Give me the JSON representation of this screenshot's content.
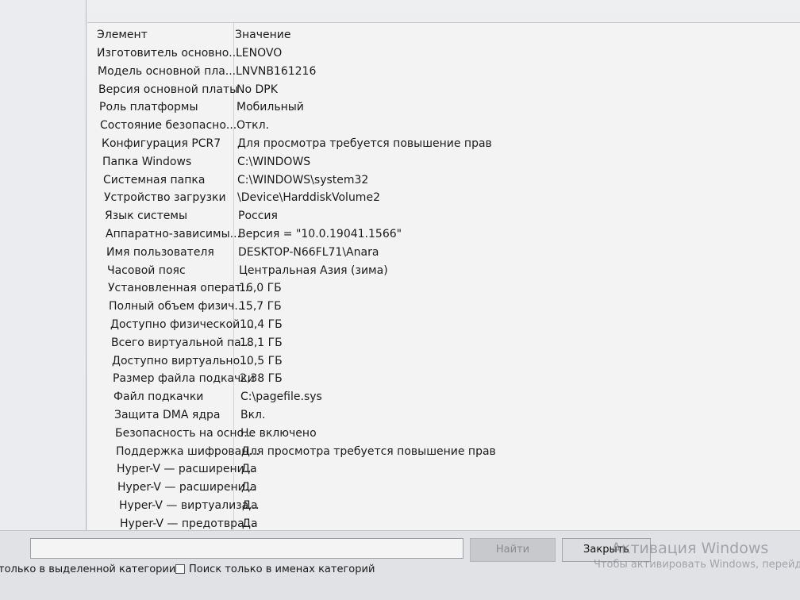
{
  "columns": {
    "name": "Элемент",
    "value": "Значение"
  },
  "rows": [
    {
      "name": "Изготовитель основно...",
      "value": "LENOVO"
    },
    {
      "name": "Модель основной пла...",
      "value": "LNVNB161216"
    },
    {
      "name": "Версия основной платы",
      "value": "No DPK"
    },
    {
      "name": "Роль платформы",
      "value": "Мобильный"
    },
    {
      "name": "Состояние безопасно...",
      "value": "Откл."
    },
    {
      "name": "Конфигурация PCR7",
      "value": "Для просмотра требуется повышение прав"
    },
    {
      "name": "Папка Windows",
      "value": "C:\\WINDOWS"
    },
    {
      "name": "Системная папка",
      "value": "C:\\WINDOWS\\system32"
    },
    {
      "name": "Устройство загрузки",
      "value": "\\Device\\HarddiskVolume2"
    },
    {
      "name": "Язык системы",
      "value": "Россия"
    },
    {
      "name": "Аппаратно-зависимы...",
      "value": "Версия = \"10.0.19041.1566\""
    },
    {
      "name": "Имя пользователя",
      "value": "DESKTOP-N66FL71\\Anara"
    },
    {
      "name": "Часовой пояс",
      "value": "Центральная Азия (зима)"
    },
    {
      "name": "Установленная операт...",
      "value": "16,0 ГБ"
    },
    {
      "name": "Полный объем физич...",
      "value": "15,7 ГБ"
    },
    {
      "name": "Доступно физической ...",
      "value": "10,4 ГБ"
    },
    {
      "name": "Всего виртуальной па...",
      "value": "18,1 ГБ"
    },
    {
      "name": "Доступно виртуально...",
      "value": "10,5 ГБ"
    },
    {
      "name": "Размер файла подкачки",
      "value": "2,38 ГБ"
    },
    {
      "name": "Файл подкачки",
      "value": "C:\\pagefile.sys"
    },
    {
      "name": "Защита DMA ядра",
      "value": "Вкл."
    },
    {
      "name": "Безопасность на осно...",
      "value": "Не включено"
    },
    {
      "name": "Поддержка шифрован...",
      "value": "Для просмотра требуется повышение прав"
    },
    {
      "name": "Hyper-V — расширени...",
      "value": "Да"
    },
    {
      "name": "Hyper-V — расширени...",
      "value": "Да"
    },
    {
      "name": "Hyper-V — виртуализа...",
      "value": "Да"
    },
    {
      "name": "Hyper-V — предотвра...",
      "value": "Да"
    }
  ],
  "bottom": {
    "search_value": "",
    "find_label": "Найти",
    "close_label": "Закрыть",
    "filter_selected_category": "только в выделенной категории",
    "filter_category_names": "Поиск только в именах категорий",
    "filter_category_names_checked": false
  },
  "watermark": {
    "title": "Активация Windows",
    "subtitle": "Чтобы активировать Windows, перейдите"
  }
}
